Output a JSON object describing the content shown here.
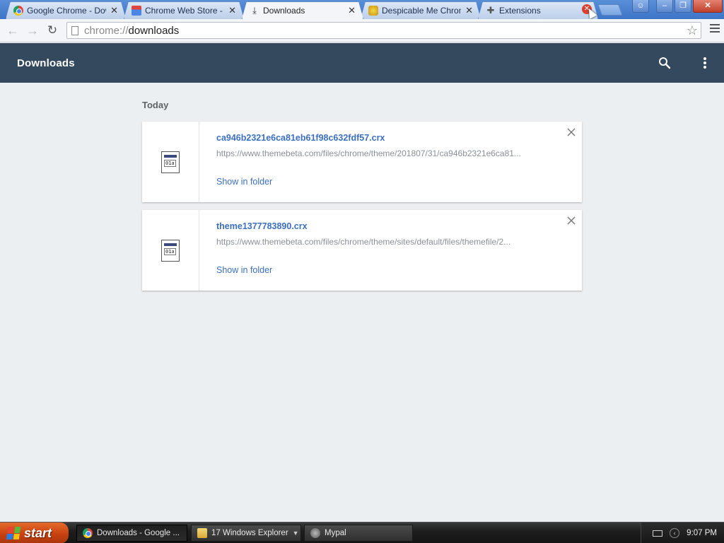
{
  "browser": {
    "tabs": [
      {
        "label": "Google Chrome - Downl",
        "icon": "chrome-icon",
        "active": false
      },
      {
        "label": "Chrome Web Store - ro",
        "icon": "web-store-icon",
        "active": false
      },
      {
        "label": "Downloads",
        "icon": "download-icon",
        "active": true
      },
      {
        "label": "Despicable Me Chrome",
        "icon": "despicable-me-icon",
        "active": false
      },
      {
        "label": "Extensions",
        "icon": "puzzle-icon",
        "active": false
      }
    ],
    "address": {
      "scheme": "chrome://",
      "path": "downloads"
    }
  },
  "page": {
    "title": "Downloads",
    "section_label": "Today",
    "downloads": [
      {
        "file_name": "ca946b2321e6ca81eb61f98c632fdf57.crx",
        "url": "https://www.themebeta.com/files/chrome/theme/201807/31/ca946b2321e6ca81...",
        "action": "Show in folder"
      },
      {
        "file_name": "theme1377783890.crx",
        "url": "https://www.themebeta.com/files/chrome/theme/sites/default/files/themefile/2...",
        "action": "Show in folder"
      }
    ]
  },
  "taskbar": {
    "start_label": "start",
    "tasks": [
      {
        "label": "Downloads - Google ...",
        "icon": "chrome-icon",
        "active": true
      },
      {
        "label": "17 Windows Explorer",
        "icon": "folder-icon",
        "active": false
      },
      {
        "label": "Mypal",
        "icon": "mypal-icon",
        "active": false
      }
    ],
    "clock": "9:07 PM"
  },
  "colors": {
    "header_bg": "#34495e",
    "page_bg": "#eceff1",
    "link": "#3b6fc1"
  }
}
